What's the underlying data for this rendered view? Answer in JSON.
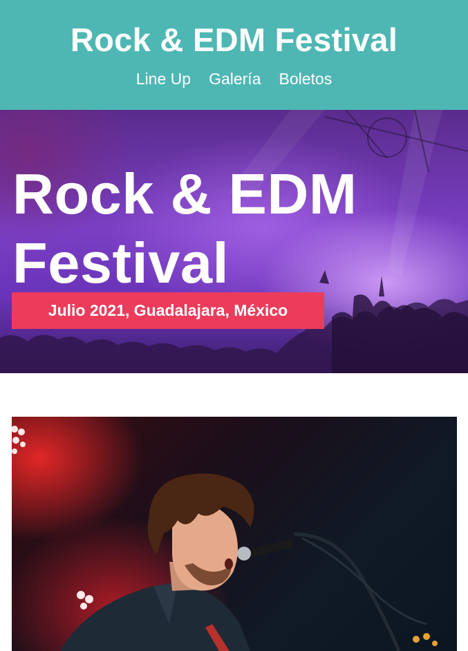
{
  "header": {
    "title": "Rock & EDM Festival",
    "nav": [
      {
        "label": "Line Up"
      },
      {
        "label": "Galería"
      },
      {
        "label": "Boletos"
      }
    ]
  },
  "hero": {
    "title": "Rock & EDM Festival",
    "badge": "Julio 2021, Guadalajara, México"
  },
  "colors": {
    "header_bg": "#4fb7b3",
    "badge_bg": "#ec3b5b",
    "hero_purple": "#7a3fc4"
  }
}
